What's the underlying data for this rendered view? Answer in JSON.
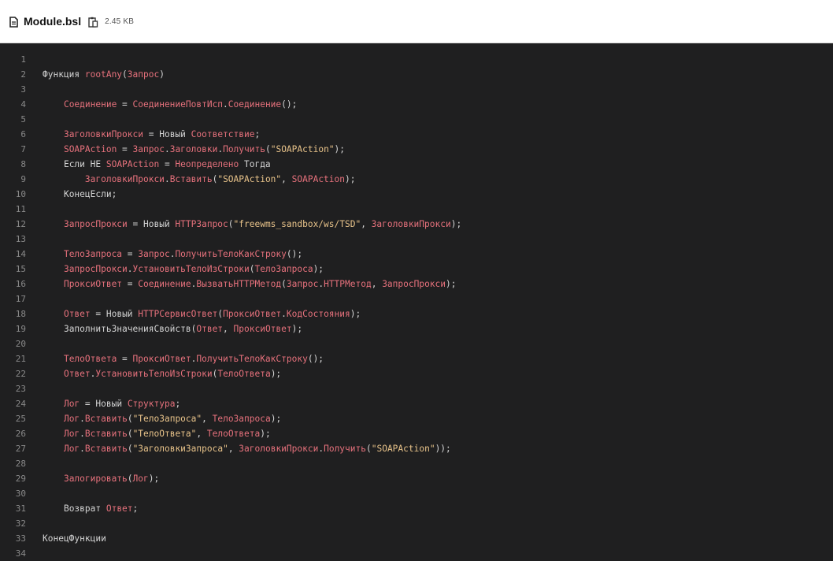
{
  "header": {
    "file_name": "Module.bsl",
    "file_size": "2.45 KB",
    "file_icon": "file-icon",
    "copy_icon": "copy-icon"
  },
  "code": {
    "colors": {
      "background": "#1f1f20",
      "identifier": "#e6717c",
      "keyword": "#d4d4d4",
      "string": "#e8c38a",
      "line_number": "#8a8a8a"
    },
    "lines": [
      {
        "n": "1",
        "tokens": []
      },
      {
        "n": "2",
        "tokens": [
          {
            "t": "Функция ",
            "c": "kw"
          },
          {
            "t": "rootAny",
            "c": "id"
          },
          {
            "t": "(",
            "c": "p"
          },
          {
            "t": "Запрос",
            "c": "id"
          },
          {
            "t": ")",
            "c": "p"
          }
        ]
      },
      {
        "n": "3",
        "tokens": []
      },
      {
        "n": "4",
        "tokens": [
          {
            "t": "    ",
            "c": "p"
          },
          {
            "t": "Соединение",
            "c": "id"
          },
          {
            "t": " = ",
            "c": "p"
          },
          {
            "t": "СоединениеПовтИсп",
            "c": "id"
          },
          {
            "t": ".",
            "c": "p"
          },
          {
            "t": "Соединение",
            "c": "id"
          },
          {
            "t": "();",
            "c": "p"
          }
        ]
      },
      {
        "n": "5",
        "tokens": []
      },
      {
        "n": "6",
        "tokens": [
          {
            "t": "    ",
            "c": "p"
          },
          {
            "t": "ЗаголовкиПрокси",
            "c": "id"
          },
          {
            "t": " = ",
            "c": "p"
          },
          {
            "t": "Новый ",
            "c": "kw"
          },
          {
            "t": "Соответствие",
            "c": "id"
          },
          {
            "t": ";",
            "c": "p"
          }
        ]
      },
      {
        "n": "7",
        "tokens": [
          {
            "t": "    ",
            "c": "p"
          },
          {
            "t": "SOAPAction",
            "c": "id"
          },
          {
            "t": " = ",
            "c": "p"
          },
          {
            "t": "Запрос",
            "c": "id"
          },
          {
            "t": ".",
            "c": "p"
          },
          {
            "t": "Заголовки",
            "c": "id"
          },
          {
            "t": ".",
            "c": "p"
          },
          {
            "t": "Получить",
            "c": "id"
          },
          {
            "t": "(",
            "c": "p"
          },
          {
            "t": "\"SOAPAction\"",
            "c": "str"
          },
          {
            "t": ");",
            "c": "p"
          }
        ]
      },
      {
        "n": "8",
        "tokens": [
          {
            "t": "    ",
            "c": "p"
          },
          {
            "t": "Если НЕ ",
            "c": "kw"
          },
          {
            "t": "SOAPAction",
            "c": "id"
          },
          {
            "t": " = ",
            "c": "p"
          },
          {
            "t": "Неопределено",
            "c": "id"
          },
          {
            "t": " Тогда",
            "c": "kw"
          }
        ]
      },
      {
        "n": "9",
        "tokens": [
          {
            "t": "        ",
            "c": "p"
          },
          {
            "t": "ЗаголовкиПрокси",
            "c": "id"
          },
          {
            "t": ".",
            "c": "p"
          },
          {
            "t": "Вставить",
            "c": "id"
          },
          {
            "t": "(",
            "c": "p"
          },
          {
            "t": "\"SOAPAction\"",
            "c": "str"
          },
          {
            "t": ", ",
            "c": "p"
          },
          {
            "t": "SOAPAction",
            "c": "id"
          },
          {
            "t": ");",
            "c": "p"
          }
        ]
      },
      {
        "n": "10",
        "tokens": [
          {
            "t": "    ",
            "c": "p"
          },
          {
            "t": "КонецЕсли;",
            "c": "kw"
          }
        ]
      },
      {
        "n": "11",
        "tokens": []
      },
      {
        "n": "12",
        "tokens": [
          {
            "t": "    ",
            "c": "p"
          },
          {
            "t": "ЗапросПрокси",
            "c": "id"
          },
          {
            "t": " = ",
            "c": "p"
          },
          {
            "t": "Новый ",
            "c": "kw"
          },
          {
            "t": "HTTPЗапрос",
            "c": "id"
          },
          {
            "t": "(",
            "c": "p"
          },
          {
            "t": "\"freewms_sandbox/ws/TSD\"",
            "c": "str"
          },
          {
            "t": ", ",
            "c": "p"
          },
          {
            "t": "ЗаголовкиПрокси",
            "c": "id"
          },
          {
            "t": ");",
            "c": "p"
          }
        ]
      },
      {
        "n": "13",
        "tokens": []
      },
      {
        "n": "14",
        "tokens": [
          {
            "t": "    ",
            "c": "p"
          },
          {
            "t": "ТелоЗапроса",
            "c": "id"
          },
          {
            "t": " = ",
            "c": "p"
          },
          {
            "t": "Запрос",
            "c": "id"
          },
          {
            "t": ".",
            "c": "p"
          },
          {
            "t": "ПолучитьТелоКакСтроку",
            "c": "id"
          },
          {
            "t": "();",
            "c": "p"
          }
        ]
      },
      {
        "n": "15",
        "tokens": [
          {
            "t": "    ",
            "c": "p"
          },
          {
            "t": "ЗапросПрокси",
            "c": "id"
          },
          {
            "t": ".",
            "c": "p"
          },
          {
            "t": "УстановитьТелоИзСтроки",
            "c": "id"
          },
          {
            "t": "(",
            "c": "p"
          },
          {
            "t": "ТелоЗапроса",
            "c": "id"
          },
          {
            "t": ");",
            "c": "p"
          }
        ]
      },
      {
        "n": "16",
        "tokens": [
          {
            "t": "    ",
            "c": "p"
          },
          {
            "t": "ПроксиОтвет",
            "c": "id"
          },
          {
            "t": " = ",
            "c": "p"
          },
          {
            "t": "Соединение",
            "c": "id"
          },
          {
            "t": ".",
            "c": "p"
          },
          {
            "t": "ВызватьHTTPМетод",
            "c": "id"
          },
          {
            "t": "(",
            "c": "p"
          },
          {
            "t": "Запрос",
            "c": "id"
          },
          {
            "t": ".",
            "c": "p"
          },
          {
            "t": "HTTPМетод",
            "c": "id"
          },
          {
            "t": ", ",
            "c": "p"
          },
          {
            "t": "ЗапросПрокси",
            "c": "id"
          },
          {
            "t": ");",
            "c": "p"
          }
        ]
      },
      {
        "n": "17",
        "tokens": []
      },
      {
        "n": "18",
        "tokens": [
          {
            "t": "    ",
            "c": "p"
          },
          {
            "t": "Ответ",
            "c": "id"
          },
          {
            "t": " = ",
            "c": "p"
          },
          {
            "t": "Новый ",
            "c": "kw"
          },
          {
            "t": "HTTPСервисОтвет",
            "c": "id"
          },
          {
            "t": "(",
            "c": "p"
          },
          {
            "t": "ПроксиОтвет",
            "c": "id"
          },
          {
            "t": ".",
            "c": "p"
          },
          {
            "t": "КодСостояния",
            "c": "id"
          },
          {
            "t": ");",
            "c": "p"
          }
        ]
      },
      {
        "n": "19",
        "tokens": [
          {
            "t": "    ",
            "c": "p"
          },
          {
            "t": "ЗаполнитьЗначенияСвойств",
            "c": "kw"
          },
          {
            "t": "(",
            "c": "p"
          },
          {
            "t": "Ответ",
            "c": "id"
          },
          {
            "t": ", ",
            "c": "p"
          },
          {
            "t": "ПроксиОтвет",
            "c": "id"
          },
          {
            "t": ");",
            "c": "p"
          }
        ]
      },
      {
        "n": "20",
        "tokens": []
      },
      {
        "n": "21",
        "tokens": [
          {
            "t": "    ",
            "c": "p"
          },
          {
            "t": "ТелоОтвета",
            "c": "id"
          },
          {
            "t": " = ",
            "c": "p"
          },
          {
            "t": "ПроксиОтвет",
            "c": "id"
          },
          {
            "t": ".",
            "c": "p"
          },
          {
            "t": "ПолучитьТелоКакСтроку",
            "c": "id"
          },
          {
            "t": "();",
            "c": "p"
          }
        ]
      },
      {
        "n": "22",
        "tokens": [
          {
            "t": "    ",
            "c": "p"
          },
          {
            "t": "Ответ",
            "c": "id"
          },
          {
            "t": ".",
            "c": "p"
          },
          {
            "t": "УстановитьТелоИзСтроки",
            "c": "id"
          },
          {
            "t": "(",
            "c": "p"
          },
          {
            "t": "ТелоОтвета",
            "c": "id"
          },
          {
            "t": ");",
            "c": "p"
          }
        ]
      },
      {
        "n": "23",
        "tokens": []
      },
      {
        "n": "24",
        "tokens": [
          {
            "t": "    ",
            "c": "p"
          },
          {
            "t": "Лог",
            "c": "id"
          },
          {
            "t": " = ",
            "c": "p"
          },
          {
            "t": "Новый ",
            "c": "kw"
          },
          {
            "t": "Структура",
            "c": "id"
          },
          {
            "t": ";",
            "c": "p"
          }
        ]
      },
      {
        "n": "25",
        "tokens": [
          {
            "t": "    ",
            "c": "p"
          },
          {
            "t": "Лог",
            "c": "id"
          },
          {
            "t": ".",
            "c": "p"
          },
          {
            "t": "Вставить",
            "c": "id"
          },
          {
            "t": "(",
            "c": "p"
          },
          {
            "t": "\"ТелоЗапроса\"",
            "c": "str"
          },
          {
            "t": ", ",
            "c": "p"
          },
          {
            "t": "ТелоЗапроса",
            "c": "id"
          },
          {
            "t": ");",
            "c": "p"
          }
        ]
      },
      {
        "n": "26",
        "tokens": [
          {
            "t": "    ",
            "c": "p"
          },
          {
            "t": "Лог",
            "c": "id"
          },
          {
            "t": ".",
            "c": "p"
          },
          {
            "t": "Вставить",
            "c": "id"
          },
          {
            "t": "(",
            "c": "p"
          },
          {
            "t": "\"ТелоОтвета\"",
            "c": "str"
          },
          {
            "t": ", ",
            "c": "p"
          },
          {
            "t": "ТелоОтвета",
            "c": "id"
          },
          {
            "t": ");",
            "c": "p"
          }
        ]
      },
      {
        "n": "27",
        "tokens": [
          {
            "t": "    ",
            "c": "p"
          },
          {
            "t": "Лог",
            "c": "id"
          },
          {
            "t": ".",
            "c": "p"
          },
          {
            "t": "Вставить",
            "c": "id"
          },
          {
            "t": "(",
            "c": "p"
          },
          {
            "t": "\"ЗаголовкиЗапроса\"",
            "c": "str"
          },
          {
            "t": ", ",
            "c": "p"
          },
          {
            "t": "ЗаголовкиПрокси",
            "c": "id"
          },
          {
            "t": ".",
            "c": "p"
          },
          {
            "t": "Получить",
            "c": "id"
          },
          {
            "t": "(",
            "c": "p"
          },
          {
            "t": "\"SOAPAction\"",
            "c": "str"
          },
          {
            "t": "));",
            "c": "p"
          }
        ]
      },
      {
        "n": "28",
        "tokens": []
      },
      {
        "n": "29",
        "tokens": [
          {
            "t": "    ",
            "c": "p"
          },
          {
            "t": "Залогировать",
            "c": "id"
          },
          {
            "t": "(",
            "c": "p"
          },
          {
            "t": "Лог",
            "c": "id"
          },
          {
            "t": ");",
            "c": "p"
          }
        ]
      },
      {
        "n": "30",
        "tokens": []
      },
      {
        "n": "31",
        "tokens": [
          {
            "t": "    ",
            "c": "p"
          },
          {
            "t": "Возврат ",
            "c": "kw"
          },
          {
            "t": "Ответ",
            "c": "id"
          },
          {
            "t": ";",
            "c": "p"
          }
        ]
      },
      {
        "n": "32",
        "tokens": []
      },
      {
        "n": "33",
        "tokens": [
          {
            "t": "КонецФункции",
            "c": "kw"
          }
        ]
      },
      {
        "n": "34",
        "tokens": []
      }
    ]
  }
}
